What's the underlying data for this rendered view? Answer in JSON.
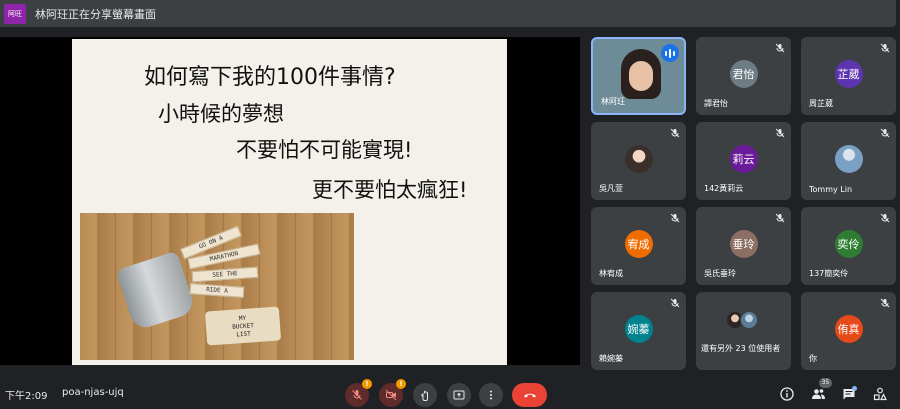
{
  "banner": {
    "avatar_text": "阿旺",
    "text": "林阿玨正在分享螢幕畫面"
  },
  "slide": {
    "title": "如何寫下我的100件事情?",
    "lines": [
      "小時候的夢想",
      "不要怕不可能實現!",
      "更不要怕太瘋狂!"
    ],
    "photo": {
      "sticks": [
        "GO ON A",
        "MARATHON",
        "SEE THE",
        "RIDE A"
      ],
      "tag": [
        "MY",
        "BUCKET",
        "LIST"
      ]
    }
  },
  "participants": [
    {
      "name": "林阿玨",
      "initials": "",
      "color": "",
      "active": true,
      "muted": false
    },
    {
      "name": "譚君怡",
      "initials": "君怡",
      "color": "#6d7b83",
      "active": false,
      "muted": true
    },
    {
      "name": "周芷葳",
      "initials": "芷葳",
      "color": "#5e35b1",
      "active": false,
      "muted": true
    },
    {
      "name": "吳凡萱",
      "initials": "",
      "color": "",
      "active": false,
      "muted": true
    },
    {
      "name": "142黃莉云",
      "initials": "莉云",
      "color": "#6a1b9a",
      "active": false,
      "muted": true
    },
    {
      "name": "Tommy Lin",
      "initials": "",
      "color": "#7aa0c4",
      "active": false,
      "muted": true
    },
    {
      "name": "林宥成",
      "initials": "宥成",
      "color": "#ef6c00",
      "active": false,
      "muted": true
    },
    {
      "name": "吳氏垂玲",
      "initials": "垂玲",
      "color": "#8d6e63",
      "active": false,
      "muted": true
    },
    {
      "name": "137簡奕伶",
      "initials": "奕伶",
      "color": "#2e7d32",
      "active": false,
      "muted": true
    },
    {
      "name": "賴婉蓁",
      "initials": "婉蓁",
      "color": "#00838f",
      "active": false,
      "muted": true
    },
    {
      "name": "還有另外 23 位使用者",
      "initials": "",
      "color": "",
      "active": false,
      "muted": true
    },
    {
      "name": "你",
      "initials": "侑真",
      "color": "#e64a19",
      "active": false,
      "muted": true
    }
  ],
  "bottom": {
    "time": "下午2:09",
    "meeting_code": "poa-njas-ujq",
    "mic_warning": "!",
    "cam_warning": "!",
    "people_count": "35"
  },
  "colors": {
    "background": "#202124",
    "tile": "#3c4043",
    "end_call": "#ea4335",
    "speaking": "#1a73e8",
    "warning": "#f29900"
  },
  "icons": [
    "mic-off-icon",
    "videocam-off-icon",
    "hand-raise-icon",
    "present-icon",
    "more-icon",
    "end-call-icon",
    "info-icon",
    "people-icon",
    "chat-icon",
    "activities-icon"
  ]
}
